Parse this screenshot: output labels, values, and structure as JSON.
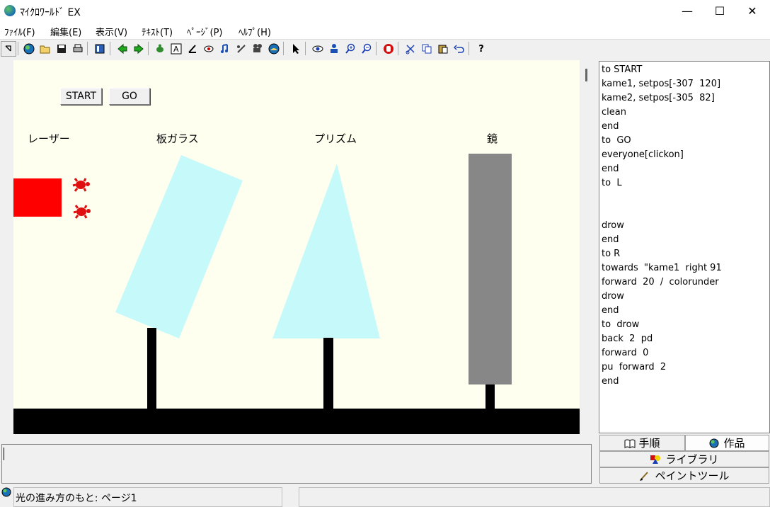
{
  "window": {
    "title": "ﾏｲｸﾛﾜｰﾙﾄﾞ EX",
    "minimize": "—",
    "maximize": "☐",
    "close": "✕"
  },
  "menu": [
    "ﾌｧｲﾙ(F)",
    "編集(E)",
    "表示(V)",
    "ﾃｷｽﾄ(T)",
    "ﾍﾟｰｼﾞ(P)",
    "ﾍﾙﾌﾟ(H)"
  ],
  "toolbar": {
    "icons": [
      "new-icon",
      "open-icon",
      "save-icon",
      "print-icon",
      "layout-icon",
      "back-icon",
      "forward-icon",
      "turtle-icon",
      "text-icon",
      "paint-icon",
      "stamp-icon",
      "music-icon",
      "pen-icon",
      "video-icon",
      "globe-icon",
      "pointer-icon",
      "eye-icon",
      "person-icon",
      "zoom-in-icon",
      "zoom-out-icon",
      "stop-icon",
      "cut-icon",
      "copy-icon",
      "paste-icon",
      "undo-icon",
      "help-icon"
    ],
    "help_label": "?"
  },
  "canvas": {
    "buttons": {
      "start": "START",
      "go": "GO"
    },
    "labels": {
      "laser": "レーザー",
      "glass": "板ガラス",
      "prism": "プリズム",
      "mirror": "鏡"
    }
  },
  "code": {
    "lines": [
      "to START",
      "kame1, setpos[-307  120]",
      "kame2, setpos[-305  82]",
      "clean",
      "end",
      "to  GO",
      "everyone[clickon]",
      "end",
      "to  L",
      "",
      "",
      "drow",
      "end",
      "to R",
      "towards  \"kame1  right 91",
      "forward  20  /  colorunder",
      "drow",
      "end",
      "to  drow",
      "back  2  pd",
      "forward  0",
      "pu  forward  2",
      "end"
    ]
  },
  "tabs": {
    "procedures": "手順",
    "works": "作品",
    "library": "ライブラリ",
    "paint_tool": "ペイントツール"
  },
  "status": {
    "page": "光の進み方のもと: ページ1"
  },
  "colors": {
    "canvas_bg": "#fffff0",
    "laser": "#ff0000",
    "glass": "#c6fafa",
    "mirror": "#878787",
    "ground": "#000000"
  }
}
